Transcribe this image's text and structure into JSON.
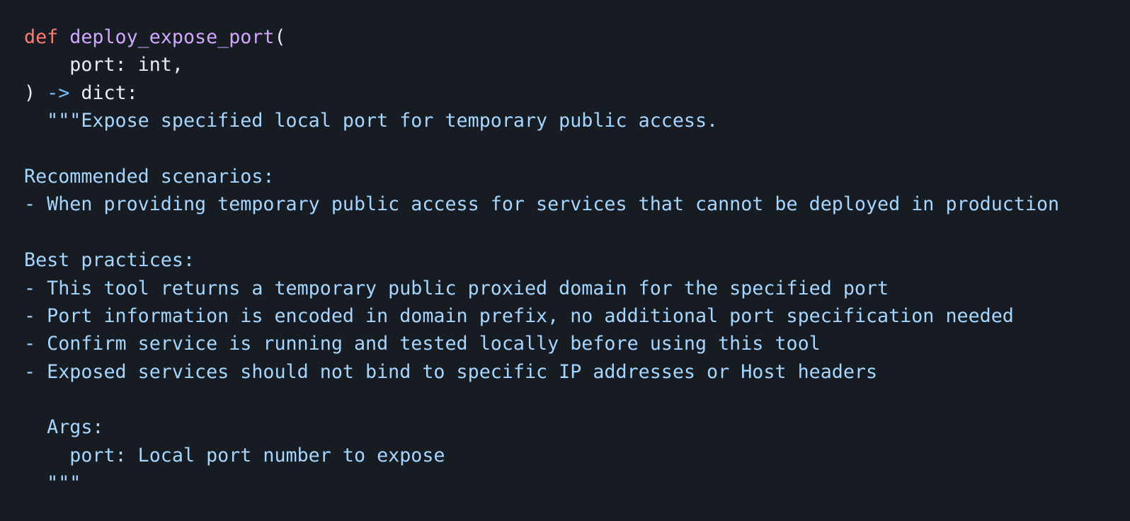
{
  "code": {
    "keyword_def": "def",
    "function_name": "deploy_expose_port",
    "open_paren": "(",
    "param_line": "    port: int,",
    "close_paren": ")",
    "arrow": "->",
    "return_type": "dict:",
    "docstring_lines": [
      "  \"\"\"Expose specified local port for temporary public access.",
      "",
      "Recommended scenarios:",
      "- When providing temporary public access for services that cannot be deployed in production",
      "",
      "Best practices:",
      "- This tool returns a temporary public proxied domain for the specified port",
      "- Port information is encoded in domain prefix, no additional port specification needed",
      "- Confirm service is running and tested locally before using this tool",
      "- Exposed services should not bind to specific IP addresses or Host headers",
      "",
      "  Args:",
      "    port: Local port number to expose",
      "  \"\"\""
    ]
  },
  "colors": {
    "background": "#171b22",
    "keyword": "#ff7b72",
    "function": "#d2a8ff",
    "operator": "#79c0ff",
    "string": "#a5d6ff",
    "text": "#e6edf3"
  }
}
